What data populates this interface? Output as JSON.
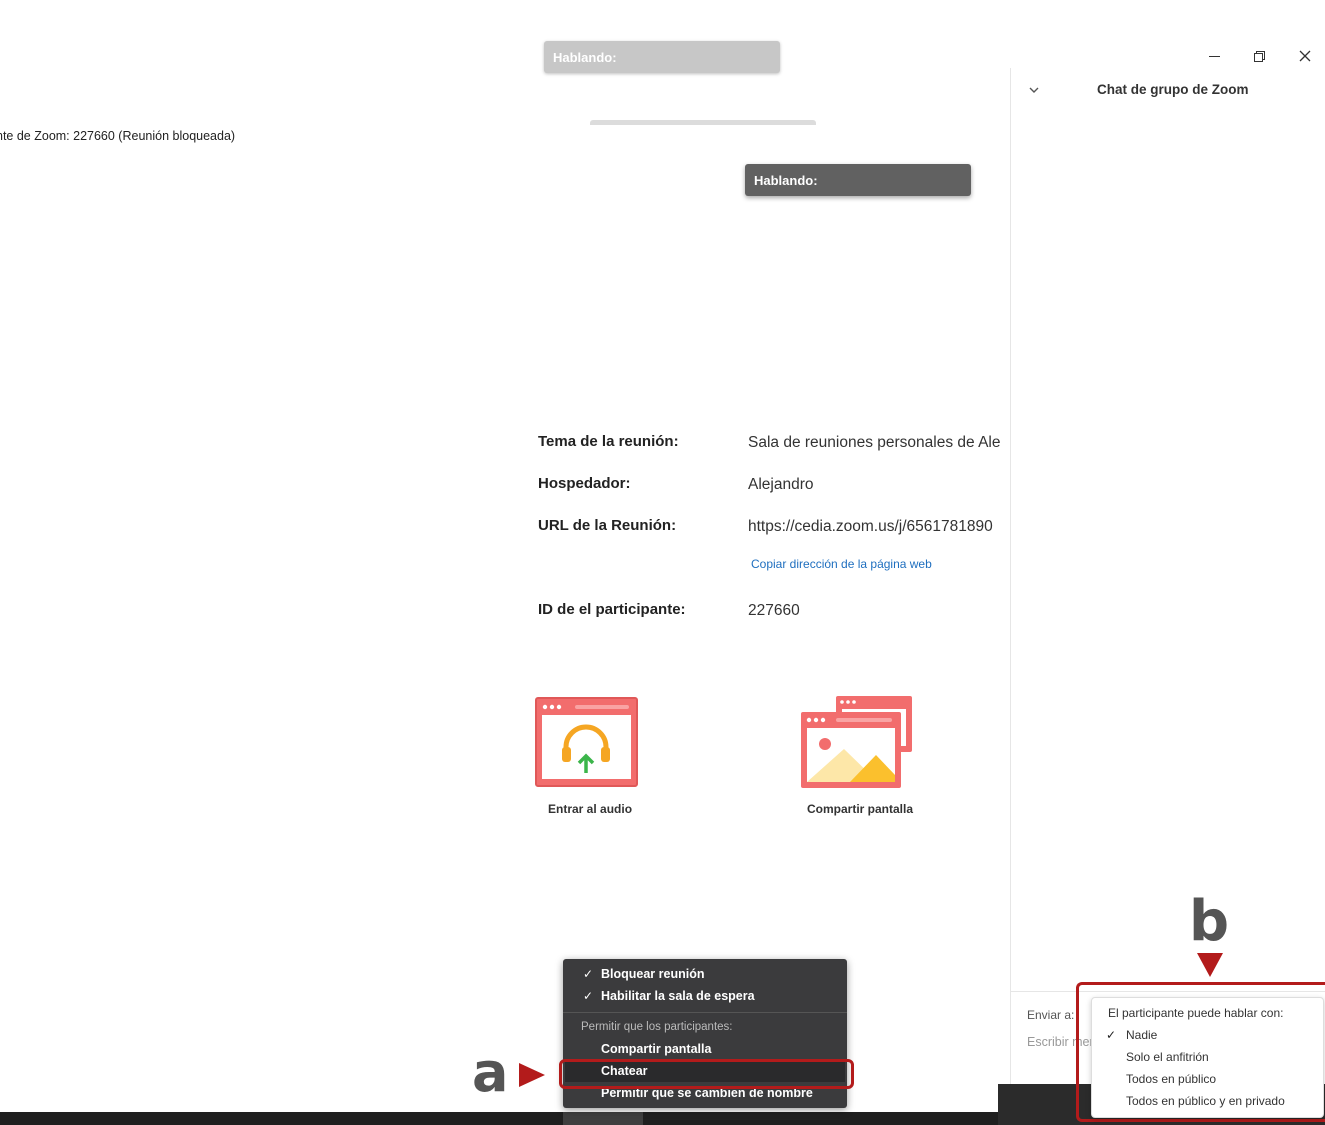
{
  "window": {
    "title": "nte de Zoom: 227660 (Reunión bloqueada)",
    "controls": {
      "minimize": "—",
      "restore": "❐",
      "close": "✕"
    }
  },
  "speaking": {
    "label_top": "Hablando:",
    "label_video": "Hablando:"
  },
  "meeting_info": {
    "topic_label": "Tema de la reunión:",
    "topic_value": "Sala de reuniones personales de Alej",
    "host_label": "Hospedador:",
    "host_value": "Alejandro",
    "url_label": "URL de la Reunión:",
    "url_value": "https://cedia.zoom.us/j/6561781890",
    "copy_link": "Copiar dirección de la página web",
    "participant_id_label": "ID de el participante:",
    "participant_id_value": "227660"
  },
  "actions": {
    "join_audio": "Entrar al audio",
    "share_screen": "Compartir pantalla"
  },
  "chat": {
    "title": "Chat de grupo de Zoom",
    "send_to_label": "Enviar a:",
    "input_placeholder": "Escribir mensaje aquí..."
  },
  "security_menu": {
    "items": [
      {
        "label": "Bloquear reunión",
        "checked": true
      },
      {
        "label": "Habilitar la sala de espera",
        "checked": true
      }
    ],
    "allow_header": "Permitir que los participantes:",
    "allow_items": [
      {
        "label": "Compartir pantalla",
        "checked": false
      },
      {
        "label": "Chatear",
        "checked": false,
        "highlighted": true
      },
      {
        "label": "Permitir que se cambien de nombre",
        "checked": false
      }
    ]
  },
  "chat_permission_popup": {
    "header": "El participante puede hablar con:",
    "options": [
      {
        "label": "Nadie",
        "checked": true
      },
      {
        "label": "Solo el anfitrión",
        "checked": false
      },
      {
        "label": "Todos en público",
        "checked": false
      },
      {
        "label": "Todos en público y en privado",
        "checked": false
      }
    ]
  },
  "annotations": {
    "a": "a",
    "b": "b"
  },
  "colors": {
    "annotation_red": "#b31b1b",
    "tile_red": "#f26d6d",
    "link_blue": "#1f6fbf",
    "menu_bg": "#3b3b3d"
  }
}
